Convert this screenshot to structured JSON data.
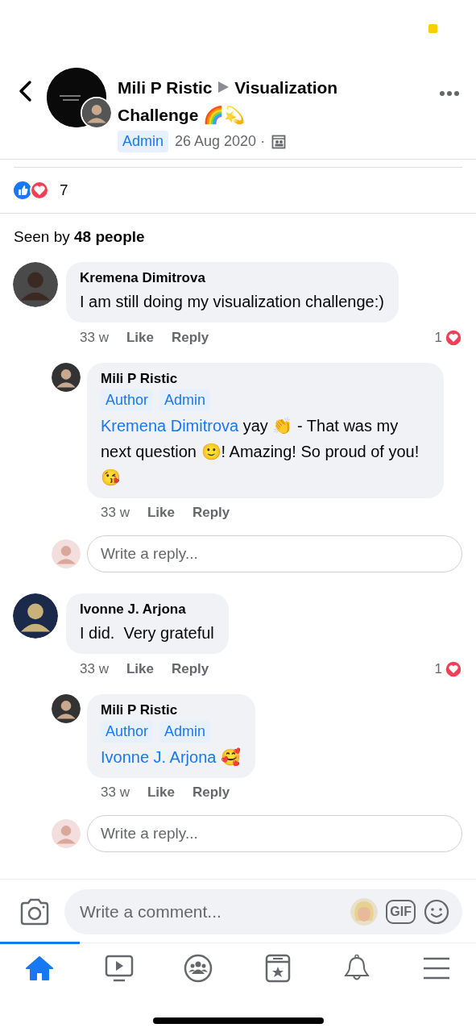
{
  "header": {
    "author": "Mili P Ristic",
    "group": "Visualization Challenge 🌈💫",
    "badge": "Admin",
    "date": "26 Aug 2020 ·"
  },
  "reactions": {
    "count": "7"
  },
  "seen": "Seen by **48 people**",
  "comments": [
    {
      "name": "Kremena Dimitrova",
      "text": "I am still doing my visualization challenge:)",
      "time": "33 w",
      "like": "Like",
      "reply": "Reply",
      "reaction_count": "1",
      "replies": [
        {
          "name": "Mili P Ristic",
          "badges": [
            "Author",
            "Admin"
          ],
          "mention": "Kremena Dimitrova",
          "text": " yay 👏 - That was my next question 🙂! Amazing! So proud of you! 😘",
          "time": "33 w",
          "like": "Like",
          "reply": "Reply"
        }
      ],
      "reply_placeholder": "Write a reply..."
    },
    {
      "name": "Ivonne J. Arjona",
      "text": "I did.  Very grateful",
      "time": "33 w",
      "like": "Like",
      "reply": "Reply",
      "reaction_count": "1",
      "replies": [
        {
          "name": "Mili P Ristic",
          "badges": [
            "Author",
            "Admin"
          ],
          "mention": "Ivonne J. Arjona",
          "text": " 🥰",
          "time": "33 w",
          "like": "Like",
          "reply": "Reply"
        }
      ],
      "reply_placeholder": "Write a reply..."
    }
  ],
  "composer": {
    "placeholder": "Write a comment...",
    "gif": "GIF"
  },
  "nav": [
    {
      "kind": "home",
      "selected": true
    },
    {
      "kind": "watch",
      "selected": false
    },
    {
      "kind": "groups",
      "selected": false
    },
    {
      "kind": "pages",
      "selected": false
    },
    {
      "kind": "bell",
      "selected": false
    },
    {
      "kind": "menu",
      "selected": false
    }
  ]
}
